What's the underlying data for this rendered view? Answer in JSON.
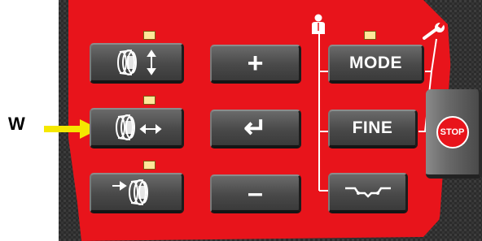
{
  "pointer_label": "W",
  "colors": {
    "panel": "#e8141b",
    "button": "#4a4a4a",
    "led": "#ffe79a",
    "arrow": "#f5e800"
  },
  "buttons": {
    "mode_label": "MODE",
    "fine_label": "FINE",
    "stop_label": "STOP",
    "plus_label": "+",
    "minus_label": "–",
    "enter_label": "↵"
  },
  "icons": {
    "wheel_vertical": "wheel-vertical-arrow-icon",
    "wheel_horizontal": "wheel-horizontal-arrow-icon",
    "wheel_offset": "wheel-offset-arrow-icon",
    "operator": "operator-person-icon",
    "service": "wrench-icon",
    "balancing_profile": "wheel-profile-icon"
  },
  "leds": [
    "led-wheel-vertical",
    "led-wheel-horizontal",
    "led-wheel-offset",
    "led-mode"
  ]
}
